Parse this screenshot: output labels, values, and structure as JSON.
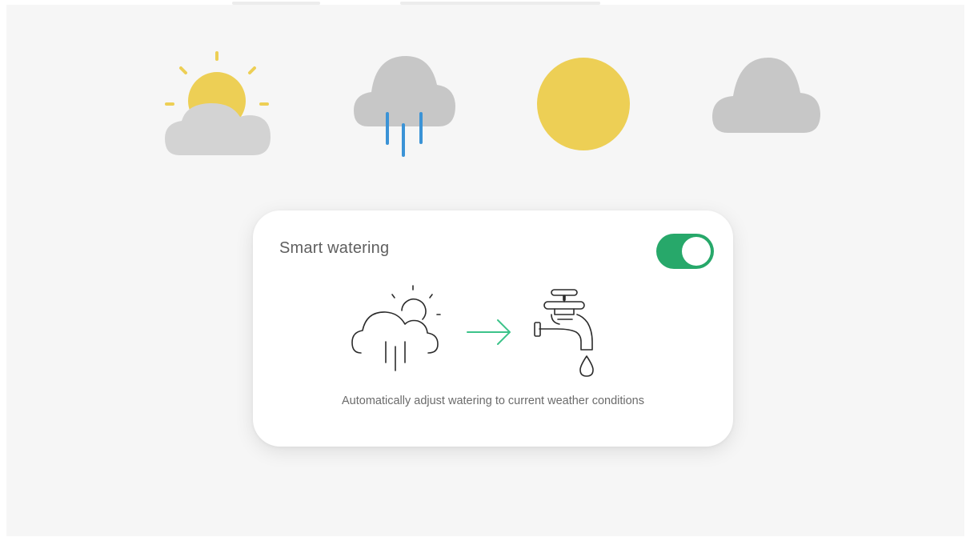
{
  "forecast": {
    "icons": [
      "partly-cloudy-icon",
      "rain-cloud-icon",
      "sun-icon",
      "cloud-icon"
    ]
  },
  "smart_watering": {
    "title": "Smart watering",
    "toggle_on": true,
    "description": "Automatically adjust watering to current weather conditions",
    "illustration_icons": [
      "weather-outline-icon",
      "arrow-right-icon",
      "faucet-icon"
    ]
  },
  "colors": {
    "sun": "#EDCF55",
    "cloud": "#C7C7C7",
    "rain": "#3B93D6",
    "toggle": "#27A86A",
    "arrow": "#3CC38A",
    "background": "#F6F6F6"
  }
}
